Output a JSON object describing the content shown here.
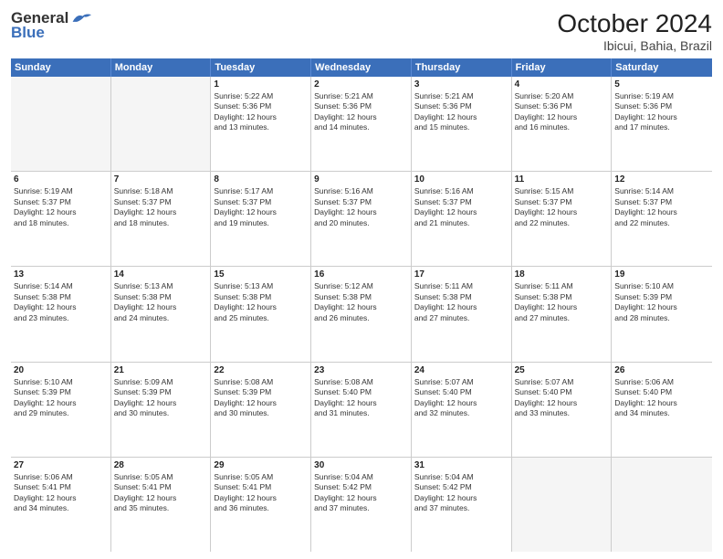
{
  "header": {
    "logo_general": "General",
    "logo_blue": "Blue",
    "title": "October 2024",
    "subtitle": "Ibicui, Bahia, Brazil"
  },
  "days_of_week": [
    "Sunday",
    "Monday",
    "Tuesday",
    "Wednesday",
    "Thursday",
    "Friday",
    "Saturday"
  ],
  "weeks": [
    [
      {
        "day": "",
        "empty": true
      },
      {
        "day": "",
        "empty": true
      },
      {
        "day": "1",
        "sunrise": "5:22 AM",
        "sunset": "5:36 PM",
        "daylight": "12 hours and 13 minutes."
      },
      {
        "day": "2",
        "sunrise": "5:21 AM",
        "sunset": "5:36 PM",
        "daylight": "12 hours and 14 minutes."
      },
      {
        "day": "3",
        "sunrise": "5:21 AM",
        "sunset": "5:36 PM",
        "daylight": "12 hours and 15 minutes."
      },
      {
        "day": "4",
        "sunrise": "5:20 AM",
        "sunset": "5:36 PM",
        "daylight": "12 hours and 16 minutes."
      },
      {
        "day": "5",
        "sunrise": "5:19 AM",
        "sunset": "5:36 PM",
        "daylight": "12 hours and 17 minutes."
      }
    ],
    [
      {
        "day": "6",
        "sunrise": "5:19 AM",
        "sunset": "5:37 PM",
        "daylight": "12 hours and 18 minutes."
      },
      {
        "day": "7",
        "sunrise": "5:18 AM",
        "sunset": "5:37 PM",
        "daylight": "12 hours and 18 minutes."
      },
      {
        "day": "8",
        "sunrise": "5:17 AM",
        "sunset": "5:37 PM",
        "daylight": "12 hours and 19 minutes."
      },
      {
        "day": "9",
        "sunrise": "5:16 AM",
        "sunset": "5:37 PM",
        "daylight": "12 hours and 20 minutes."
      },
      {
        "day": "10",
        "sunrise": "5:16 AM",
        "sunset": "5:37 PM",
        "daylight": "12 hours and 21 minutes."
      },
      {
        "day": "11",
        "sunrise": "5:15 AM",
        "sunset": "5:37 PM",
        "daylight": "12 hours and 22 minutes."
      },
      {
        "day": "12",
        "sunrise": "5:14 AM",
        "sunset": "5:37 PM",
        "daylight": "12 hours and 22 minutes."
      }
    ],
    [
      {
        "day": "13",
        "sunrise": "5:14 AM",
        "sunset": "5:38 PM",
        "daylight": "12 hours and 23 minutes."
      },
      {
        "day": "14",
        "sunrise": "5:13 AM",
        "sunset": "5:38 PM",
        "daylight": "12 hours and 24 minutes."
      },
      {
        "day": "15",
        "sunrise": "5:13 AM",
        "sunset": "5:38 PM",
        "daylight": "12 hours and 25 minutes."
      },
      {
        "day": "16",
        "sunrise": "5:12 AM",
        "sunset": "5:38 PM",
        "daylight": "12 hours and 26 minutes."
      },
      {
        "day": "17",
        "sunrise": "5:11 AM",
        "sunset": "5:38 PM",
        "daylight": "12 hours and 27 minutes."
      },
      {
        "day": "18",
        "sunrise": "5:11 AM",
        "sunset": "5:38 PM",
        "daylight": "12 hours and 27 minutes."
      },
      {
        "day": "19",
        "sunrise": "5:10 AM",
        "sunset": "5:39 PM",
        "daylight": "12 hours and 28 minutes."
      }
    ],
    [
      {
        "day": "20",
        "sunrise": "5:10 AM",
        "sunset": "5:39 PM",
        "daylight": "12 hours and 29 minutes."
      },
      {
        "day": "21",
        "sunrise": "5:09 AM",
        "sunset": "5:39 PM",
        "daylight": "12 hours and 30 minutes."
      },
      {
        "day": "22",
        "sunrise": "5:08 AM",
        "sunset": "5:39 PM",
        "daylight": "12 hours and 30 minutes."
      },
      {
        "day": "23",
        "sunrise": "5:08 AM",
        "sunset": "5:40 PM",
        "daylight": "12 hours and 31 minutes."
      },
      {
        "day": "24",
        "sunrise": "5:07 AM",
        "sunset": "5:40 PM",
        "daylight": "12 hours and 32 minutes."
      },
      {
        "day": "25",
        "sunrise": "5:07 AM",
        "sunset": "5:40 PM",
        "daylight": "12 hours and 33 minutes."
      },
      {
        "day": "26",
        "sunrise": "5:06 AM",
        "sunset": "5:40 PM",
        "daylight": "12 hours and 34 minutes."
      }
    ],
    [
      {
        "day": "27",
        "sunrise": "5:06 AM",
        "sunset": "5:41 PM",
        "daylight": "12 hours and 34 minutes."
      },
      {
        "day": "28",
        "sunrise": "5:05 AM",
        "sunset": "5:41 PM",
        "daylight": "12 hours and 35 minutes."
      },
      {
        "day": "29",
        "sunrise": "5:05 AM",
        "sunset": "5:41 PM",
        "daylight": "12 hours and 36 minutes."
      },
      {
        "day": "30",
        "sunrise": "5:04 AM",
        "sunset": "5:42 PM",
        "daylight": "12 hours and 37 minutes."
      },
      {
        "day": "31",
        "sunrise": "5:04 AM",
        "sunset": "5:42 PM",
        "daylight": "12 hours and 37 minutes."
      },
      {
        "day": "",
        "empty": true
      },
      {
        "day": "",
        "empty": true
      }
    ]
  ],
  "labels": {
    "sunrise": "Sunrise:",
    "sunset": "Sunset:",
    "daylight": "Daylight:"
  }
}
